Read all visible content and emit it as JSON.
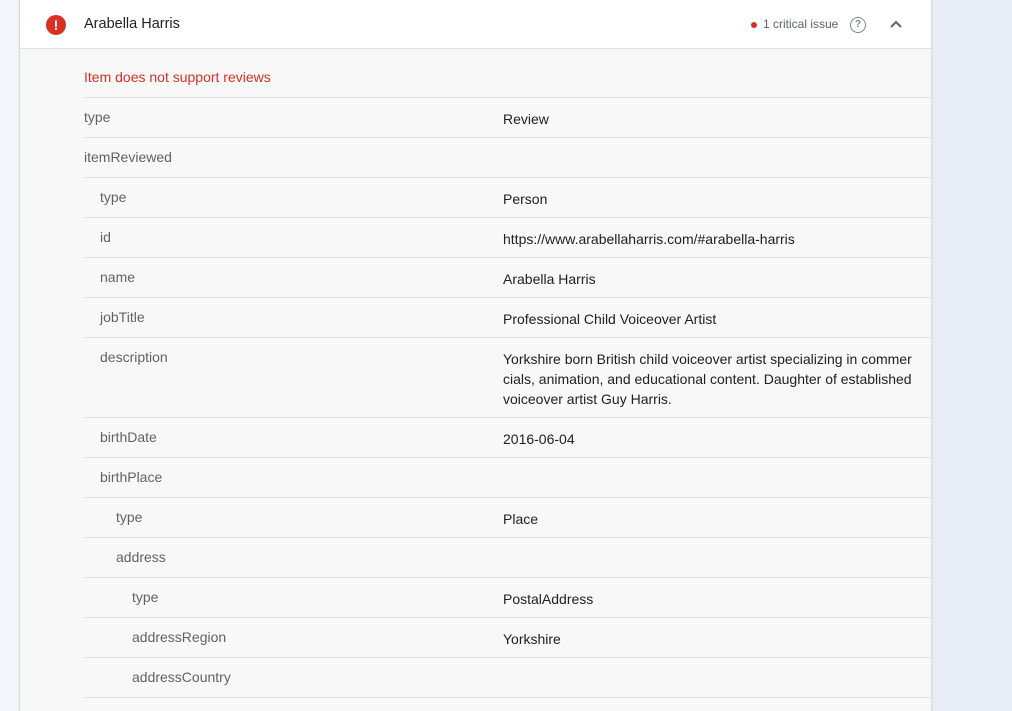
{
  "item": {
    "title": "Arabella Harris",
    "issue_summary": "1 critical issue",
    "error_message": "Item does not support reviews"
  },
  "colors": {
    "error": "#d93025",
    "text_primary": "#202124",
    "text_secondary": "#5f6368",
    "background": "#e9eef6"
  },
  "icons": {
    "status": "error-circle-icon",
    "help": "help-circle-icon",
    "collapse": "chevron-up-icon"
  },
  "properties": [
    {
      "key": "type",
      "value": "Review",
      "depth": 0
    },
    {
      "key": "itemReviewed",
      "value": "",
      "depth": 0
    },
    {
      "key": "type",
      "value": "Person",
      "depth": 1
    },
    {
      "key": "id",
      "value": "https://www.arabellaharris.com/#arabella-harris",
      "depth": 1
    },
    {
      "key": "name",
      "value": "Arabella Harris",
      "depth": 1
    },
    {
      "key": "jobTitle",
      "value": "Professional Child Voiceover Artist",
      "depth": 1
    },
    {
      "key": "description",
      "value": "Yorkshire born British child voiceover artist specializing in commercials, animation, and educational content. Daughter of established voiceover artist Guy Harris.",
      "depth": 1
    },
    {
      "key": "birthDate",
      "value": "2016-06-04",
      "depth": 1
    },
    {
      "key": "birthPlace",
      "value": "",
      "depth": 1
    },
    {
      "key": "type",
      "value": "Place",
      "depth": 2
    },
    {
      "key": "address",
      "value": "",
      "depth": 2
    },
    {
      "key": "type",
      "value": "PostalAddress",
      "depth": 3
    },
    {
      "key": "addressRegion",
      "value": "Yorkshire",
      "depth": 3
    },
    {
      "key": "addressCountry",
      "value": "",
      "depth": 3
    }
  ]
}
